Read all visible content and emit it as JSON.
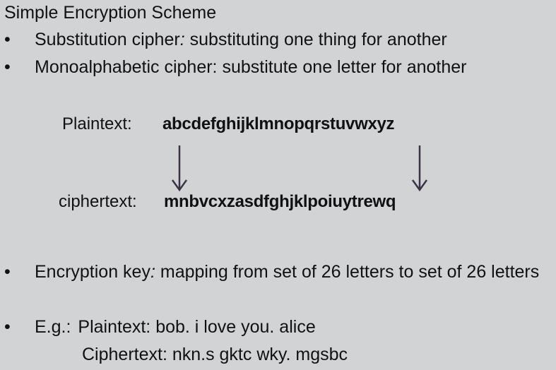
{
  "title": "Simple Encryption Scheme",
  "bullets": [
    {
      "term": "Substitution cipher",
      "colon": ":",
      "desc": " substituting one thing for another"
    },
    {
      "text": "Monoalphabetic cipher: substitute one letter for another"
    },
    {
      "term": "Encryption key",
      "colon": ":",
      "desc": " mapping from set of 26 letters to set of 26 letters"
    },
    {
      "label": "E.g.:",
      "line1": "Plaintext: bob. i love you. alice",
      "line2": "Ciphertext: nkn.s gktc wky. mgsbc"
    }
  ],
  "bullet_char": "•",
  "mapping": {
    "plaintext_label": "Plaintext:",
    "plaintext_value": "abcdefghijklmnopqrstuvwxyz",
    "ciphertext_label": "ciphertext:",
    "ciphertext_value": "mnbvcxzasdfghjklpoiuytrewq"
  },
  "colors": {
    "background": "#d2d3d5",
    "text": "#111111",
    "arrow": "#3b3346"
  }
}
